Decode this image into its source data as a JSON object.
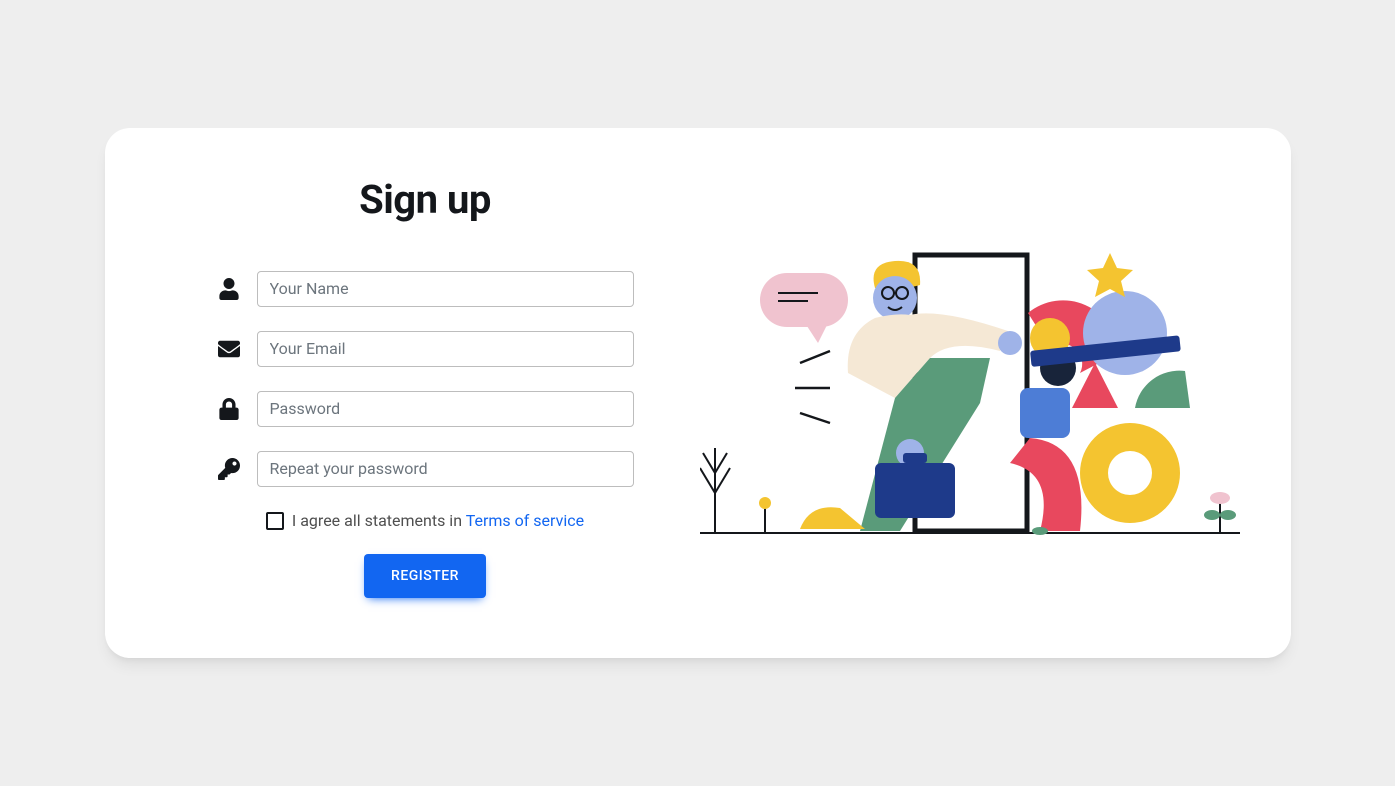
{
  "title": "Sign up",
  "fields": {
    "name": {
      "placeholder": "Your Name",
      "value": ""
    },
    "email": {
      "placeholder": "Your Email",
      "value": ""
    },
    "password": {
      "placeholder": "Password",
      "value": ""
    },
    "repeat_password": {
      "placeholder": "Repeat your password",
      "value": ""
    }
  },
  "agree": {
    "text_before": "I agree all statements in ",
    "link_text": "Terms of service"
  },
  "register_label": "Register",
  "colors": {
    "primary": "#1266f1",
    "bg": "#eee",
    "card": "#fff"
  }
}
